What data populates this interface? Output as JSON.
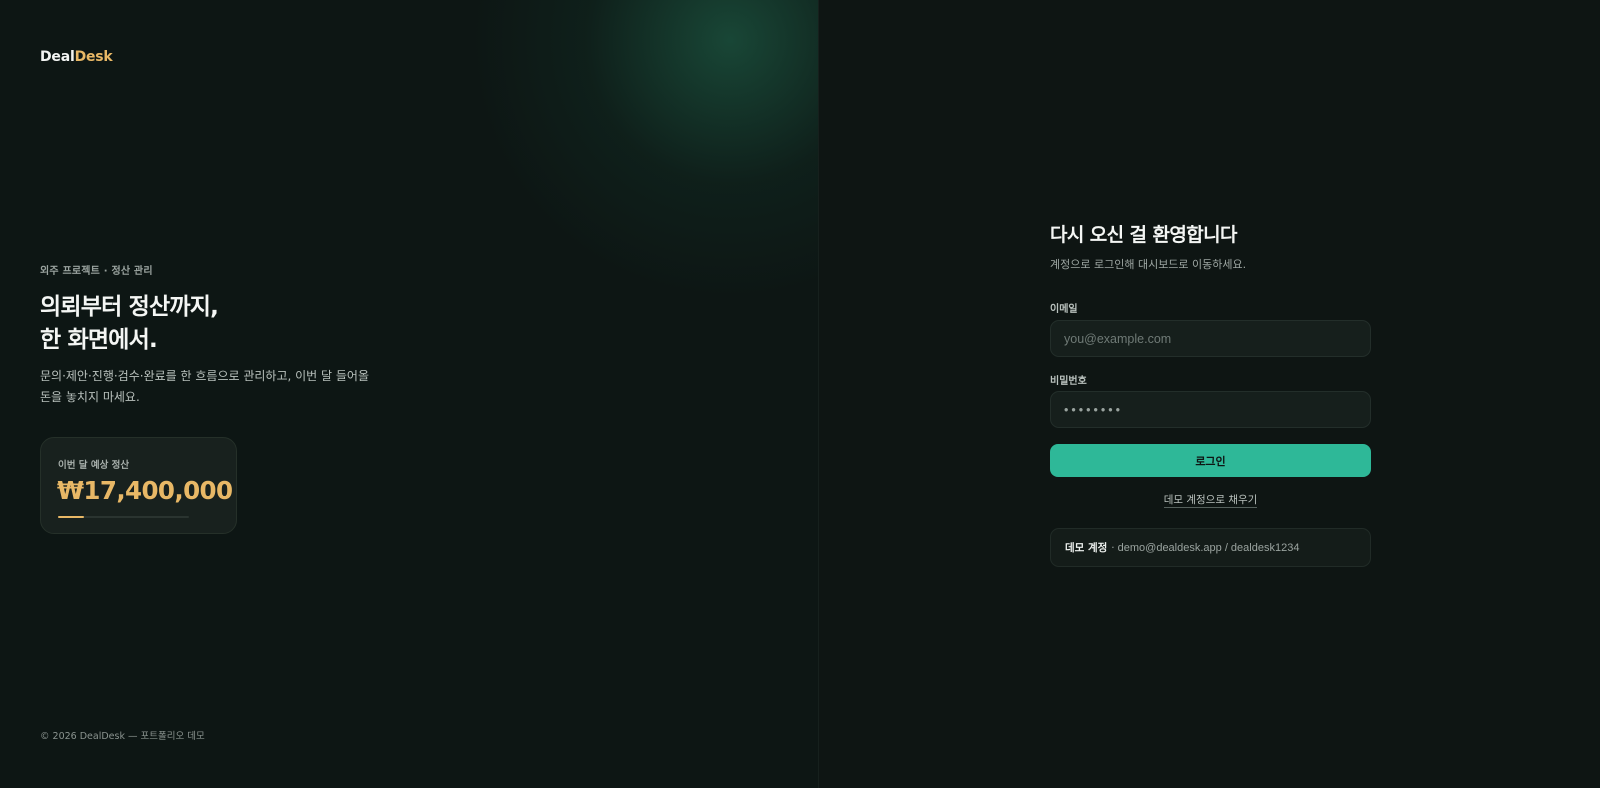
{
  "brand": {
    "part1": "Deal",
    "part2": "Desk"
  },
  "hero": {
    "eyebrow": "외주 프로젝트 · 정산 관리",
    "headline_line1": "의뢰부터 정산까지,",
    "headline_line2": "한 화면에서.",
    "description_line1": "문의·제안·진행·검수·완료를 한 흐름으로 관리하고, 이번 달 들어올",
    "description_line2": "돈을 놓치지 마세요."
  },
  "settlement_card": {
    "label": "이번 달 예상 정산",
    "amount": "₩17,400,000",
    "progress_percent": 20
  },
  "footer": "© 2026 DealDesk — 포트폴리오 데모",
  "login": {
    "title": "다시 오신 걸 환영합니다",
    "subtitle": "계정으로 로그인해 대시보드로 이동하세요.",
    "email_label": "이메일",
    "email_placeholder": "you@example.com",
    "password_label": "비밀번호",
    "password_value": "••••••••",
    "submit_label": "로그인",
    "demo_fill_link": "데모 계정으로 채우기",
    "demo_box_label": "데모 계정",
    "demo_box_separator": "·",
    "demo_box_credentials": "demo@dealdesk.app / dealdesk1234"
  },
  "colors": {
    "accent": "#2eb898",
    "gold": "#e8b866",
    "background": "#0e1513"
  }
}
